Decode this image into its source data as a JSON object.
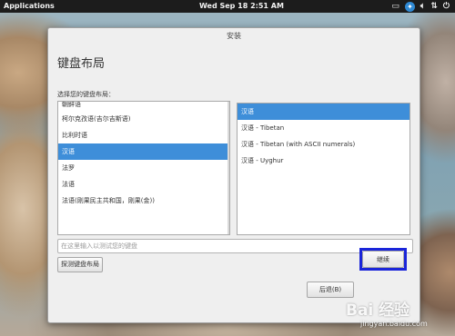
{
  "top_panel": {
    "applications_label": "Applications",
    "clock": "Wed Sep 18  2:51 AM",
    "icons": [
      "network-icon",
      "accessibility-icon",
      "volume-icon",
      "transfer-icon",
      "power-icon"
    ]
  },
  "window": {
    "title": "安装",
    "page_title": "键盘布局",
    "prompt": "选择您的键盘布局："
  },
  "layouts": {
    "items": [
      {
        "label": "朝鲜语"
      },
      {
        "label": "柯尔克孜语(吉尔吉斯语)"
      },
      {
        "label": "比利时语"
      },
      {
        "label": "汉语"
      },
      {
        "label": "法罗"
      },
      {
        "label": "法语"
      },
      {
        "label": "法语(刚果民主共和国，刚果(金))"
      }
    ],
    "selected": "汉语"
  },
  "variants": {
    "items": [
      {
        "label": "汉语"
      },
      {
        "label": "汉语 - Tibetan"
      },
      {
        "label": "汉语 - Tibetan (with ASCII numerals)"
      },
      {
        "label": "汉语 - Uyghur"
      }
    ],
    "selected": "汉语"
  },
  "test_input": {
    "placeholder": "在这里输入以测试您的键盘",
    "value": ""
  },
  "buttons": {
    "detect": "探测键盘布局",
    "back": "后退(B)",
    "continue": "继续"
  },
  "colors": {
    "selection": "#3e8ed9",
    "highlight_box": "#1a25d9",
    "panel": "#1c1c1c"
  },
  "watermark": {
    "main": "Bai 经验",
    "sub": "jingyan.baidu.com"
  }
}
